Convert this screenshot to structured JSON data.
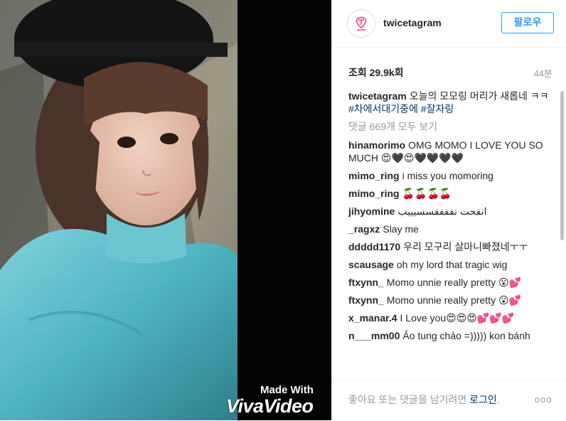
{
  "media": {
    "watermark_line1": "Made With",
    "watermark_line2": "VivaVideo"
  },
  "header": {
    "username": "twicetagram",
    "follow_label": "팔로우"
  },
  "stats": {
    "views": "조회 29.9k회",
    "time": "44분"
  },
  "caption": {
    "username": "twicetagram",
    "text": "오늘의 모모링 머리가 새롭네 ㅋㅋ",
    "hashtags": "#차에서대기중에 #잘자링"
  },
  "load_more": "댓글 669개 모두 보기",
  "comments": [
    {
      "user": "hinamorimo",
      "text": "OMG MOMO I LOVE YOU SO MUCH 😍🖤😍🖤🖤🖤🖤"
    },
    {
      "user": "mimo_ring",
      "text": "i miss you momoring"
    },
    {
      "user": "mimo_ring",
      "text": "🍒🍒🍒🍒"
    },
    {
      "user": "jihyomine",
      "text": "انفحت نففففسسيييب"
    },
    {
      "user": "_ragxz",
      "text": "Slay me"
    },
    {
      "user": "ddddd1170",
      "text": "우리 모구리 살마니빠졌네ㅜㅜ"
    },
    {
      "user": "scausage",
      "text": "oh my lord that tragic wig"
    },
    {
      "user": "ftxynn_",
      "text": "Momo unnie really pretty 😮💕"
    },
    {
      "user": "ftxynn_",
      "text": "Momo unnie really pretty 😮💕"
    },
    {
      "user": "x_manar.4",
      "text": "I Love you😍😍😍💕💕💕"
    },
    {
      "user": "n___mm00",
      "text": "Ảo tung chảo =))))) kon bánh"
    }
  ],
  "footer": {
    "prompt": "좋아요 또는 댓글을 남기려면",
    "login": "로그인",
    "period": ".",
    "more": "ooo"
  },
  "colors": {
    "link": "#003569",
    "follow": "#3897f0",
    "muted": "#999999"
  }
}
